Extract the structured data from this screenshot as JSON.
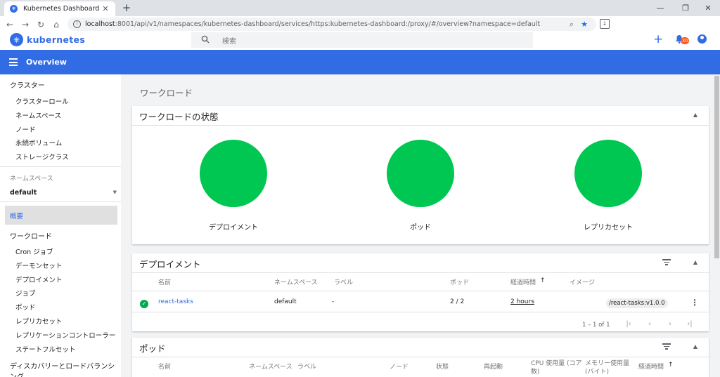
{
  "browser": {
    "tab_title": "Kubernetes Dashboard",
    "tab_close": "✕",
    "new_tab": "+",
    "url_host": "localhost",
    "url_rest": ":8001/api/v1/namespaces/kubernetes-dashboard/services/https:kubernetes-dashboard:/proxy/#/overview?namespace=default",
    "controls": {
      "minimize": "—",
      "maximize": "❐",
      "close": "✕"
    },
    "nav": {
      "back": "←",
      "forward": "→",
      "reload": "↻",
      "home": "⌂"
    }
  },
  "app": {
    "brand": "kubernetes",
    "search_placeholder": "検索",
    "notification_count": "30",
    "page_title": "Overview"
  },
  "sidebar": {
    "cluster": {
      "title": "クラスター",
      "items": [
        "クラスターロール",
        "ネームスペース",
        "ノード",
        "永続ボリューム",
        "ストレージクラス"
      ]
    },
    "namespace_label": "ネームスペース",
    "namespace_value": "default",
    "active_item": "概要",
    "workloads": {
      "title": "ワークロード",
      "items": [
        "Cron ジョブ",
        "デーモンセット",
        "デプロイメント",
        "ジョブ",
        "ポッド",
        "レプリカセット",
        "レプリケーションコントローラー",
        "ステートフルセット"
      ]
    },
    "discovery_title": "ディスカバリーとロードバランシング"
  },
  "main": {
    "heading": "ワークロード",
    "status_card": {
      "title": "ワークロードの状態",
      "charts": [
        {
          "label": "デプロイメント",
          "color": "#00c752"
        },
        {
          "label": "ポッド",
          "color": "#00c752"
        },
        {
          "label": "レプリカセット",
          "color": "#00c752"
        }
      ]
    },
    "deployments": {
      "title": "デプロイメント",
      "columns": {
        "name": "名前",
        "namespace": "ネームスペース",
        "labels": "ラベル",
        "pods": "ポッド",
        "age": "経過時間",
        "age_sort": "↑",
        "images": "イメージ"
      },
      "row": {
        "name": "react-tasks",
        "namespace": "default",
        "labels": "-",
        "pods": "2 / 2",
        "age": "2 hours",
        "image": "/react-tasks:v1.0.0"
      },
      "pagination": "1 – 1 of 1"
    },
    "pods": {
      "title": "ポッド",
      "columns": {
        "name": "名前",
        "namespace": "ネームスペース",
        "labels": "ラベル",
        "node": "ノード",
        "status": "状態",
        "restarts": "再起動",
        "cpu_1": "CPU 使用量 (コア",
        "cpu_2": "数)",
        "mem_1": "メモリー使用量",
        "mem_2": "(バイト)",
        "age": "経過時間",
        "age_sort": "↑"
      }
    }
  },
  "colors": {
    "primary": "#326ce5",
    "healthy": "#00c752",
    "badge": "#ff5722"
  }
}
